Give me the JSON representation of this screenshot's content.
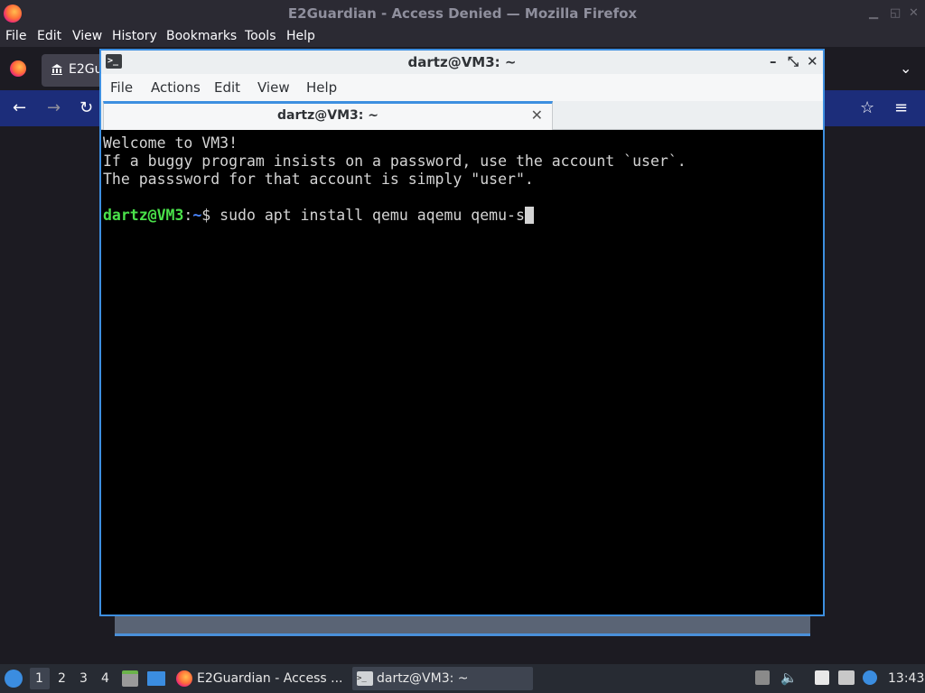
{
  "firefox": {
    "window_title": "E2Guardian - Access Denied — Mozilla Firefox",
    "menu": [
      "File",
      "Edit",
      "View",
      "History",
      "Bookmarks",
      "Tools",
      "Help"
    ],
    "tab_label": "E2Gu"
  },
  "terminal": {
    "window_title": "dartz@VM3: ~",
    "menu": [
      "File",
      "Actions",
      "Edit",
      "View",
      "Help"
    ],
    "tab_label": "dartz@VM3: ~",
    "lines": [
      "Welcome to VM3!",
      "If a buggy program insists on a password, use the account `user`.",
      "The passsword for that account is simply \"user\"."
    ],
    "prompt_user": "dartz@VM3",
    "prompt_path": "~",
    "prompt_symbol": "$ ",
    "command": "sudo apt install qemu aqemu qemu-s"
  },
  "taskbar": {
    "workspaces": [
      "1",
      "2",
      "3",
      "4"
    ],
    "tasks": [
      "E2Guardian - Access ...",
      "dartz@VM3: ~"
    ],
    "clock": "13:43"
  }
}
